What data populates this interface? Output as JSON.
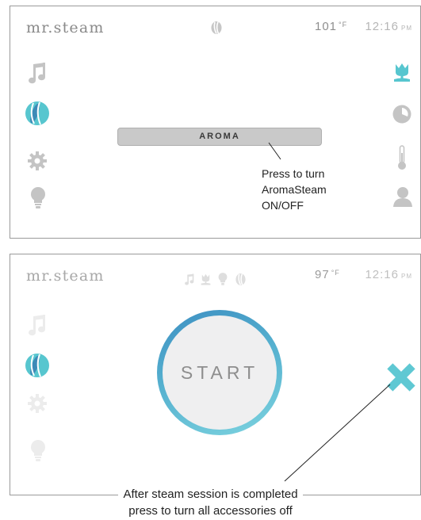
{
  "screen1": {
    "brand": "mr.steam",
    "temperature": "101",
    "temp_unit": "°F",
    "time": "12:16",
    "ampm": "PM",
    "aroma_button": "AROMA",
    "annotation": [
      "Press to turn",
      "AromaSteam",
      "ON/OFF"
    ],
    "icons_left": [
      "music-icon",
      "aroma-leaf-icon",
      "gear-icon",
      "lightbulb-icon"
    ],
    "icons_right": [
      "tulip-icon",
      "clock-icon",
      "thermometer-icon",
      "user-icon"
    ],
    "status_icon": "aroma-leaf-icon"
  },
  "screen2": {
    "brand": "mr.steam",
    "temperature": "97",
    "temp_unit": "°F",
    "time": "12:16",
    "ampm": "PM",
    "start_label": "START",
    "status_icons": [
      "music-icon",
      "tulip-icon",
      "lightbulb-icon",
      "aroma-leaf-icon"
    ],
    "close_icon": "close-x-icon"
  },
  "caption": [
    "After steam session is completed",
    "press to turn all accessories off"
  ],
  "colors": {
    "accent_teal": "#57c6cf",
    "aroma_active": "#49b3c8",
    "ring_start": "#3d8fc2",
    "ring_end": "#7cd3df",
    "icon_gray": "#c4c4c4",
    "icon_faded": "#ebebeb",
    "button_gray": "#c9c9c9"
  }
}
